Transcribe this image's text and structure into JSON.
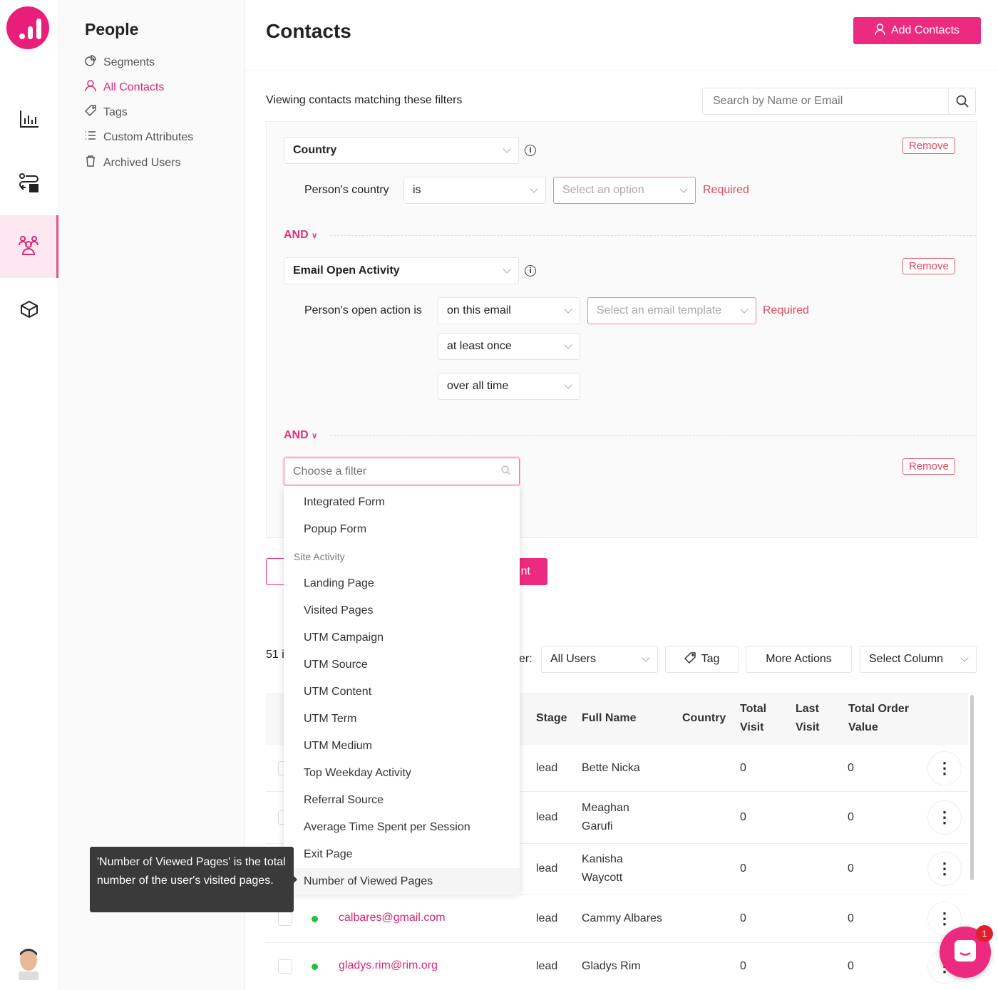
{
  "colors": {
    "accent": "#ec2a7f",
    "required": "#e04a5f",
    "success": "#22c23a"
  },
  "rail": {
    "items": [
      {
        "icon": "bar-chart-icon"
      },
      {
        "icon": "automation-icon"
      },
      {
        "icon": "people-icon",
        "active": true
      },
      {
        "icon": "box-icon"
      }
    ]
  },
  "sidebar": {
    "title": "People",
    "items": [
      {
        "label": "Segments",
        "icon": "pie-chart-icon"
      },
      {
        "label": "All Contacts",
        "icon": "user-icon",
        "active": true
      },
      {
        "label": "Tags",
        "icon": "tag-icon"
      },
      {
        "label": "Custom Attributes",
        "icon": "list-icon"
      },
      {
        "label": "Archived Users",
        "icon": "trash-icon"
      }
    ]
  },
  "header": {
    "title": "Contacts",
    "add_button": "Add Contacts"
  },
  "filters": {
    "intro": "Viewing contacts matching these filters",
    "search_placeholder": "Search by Name or Email",
    "remove_label": "Remove",
    "and_label": "AND",
    "required_label": "Required",
    "f1": {
      "field": "Country",
      "label": "Person's country",
      "operator": "is",
      "value_placeholder": "Select an option"
    },
    "f2": {
      "field": "Email Open Activity",
      "label": "Person's open action is",
      "operator": "on this email",
      "value_placeholder": "Select an email template",
      "frequency": "at least once",
      "period": "over all time"
    },
    "f3": {
      "placeholder": "Choose a filter"
    }
  },
  "actions": {
    "save_partial": "nt"
  },
  "dropdown": {
    "items_top": [
      "Integrated Form",
      "Popup Form"
    ],
    "group": "Site Activity",
    "items": [
      "Landing Page",
      "Visited Pages",
      "UTM Campaign",
      "UTM Source",
      "UTM Content",
      "UTM Term",
      "UTM Medium",
      "Top Weekday Activity",
      "Referral Source",
      "Average Time Spent per Session",
      "Exit Page",
      "Number of Viewed Pages"
    ],
    "highlighted": "Number of Viewed Pages"
  },
  "tooltip": "'Number of Viewed Pages' is the total number of the user's visited pages.",
  "toolbar": {
    "count_partial": "51 i",
    "filter_label_partial": "er:",
    "users_select": "All Users",
    "tag": "Tag",
    "more": "More Actions",
    "columns": "Select Column"
  },
  "table": {
    "headers": {
      "stage": "Stage",
      "name": "Full Name",
      "country": "Country",
      "total_visit_1": "Total",
      "total_visit_2": "Visit",
      "last_visit_1": "Last",
      "last_visit_2": "Visit",
      "order_1": "Total Order",
      "order_2": "Value"
    },
    "rows": [
      {
        "email": "",
        "stage": "lead",
        "name1": "Bette Nicka",
        "name2": "",
        "total": "0",
        "order": "0"
      },
      {
        "email": "",
        "stage": "lead",
        "name1": "Meaghan",
        "name2": "Garufi",
        "total": "0",
        "order": "0"
      },
      {
        "email": "",
        "stage": "lead",
        "name1": "Kanisha",
        "name2": "Waycott",
        "total": "0",
        "order": "0"
      },
      {
        "email": "calbares@gmail.com",
        "stage": "lead",
        "name1": "Cammy Albares",
        "name2": "",
        "total": "0",
        "order": "0"
      },
      {
        "email": "gladys.rim@rim.org",
        "stage": "lead",
        "name1": "Gladys Rim",
        "name2": "",
        "total": "0",
        "order": "0"
      }
    ]
  },
  "chat": {
    "badge": "1"
  }
}
